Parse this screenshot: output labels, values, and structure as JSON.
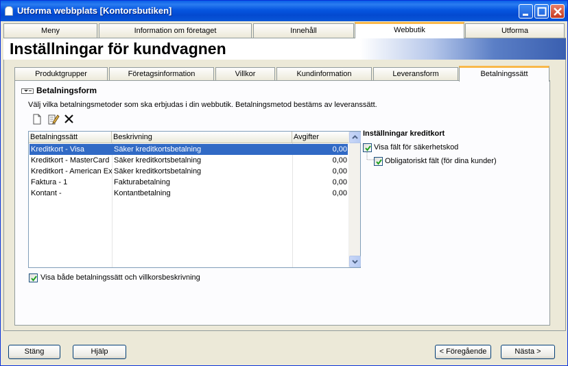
{
  "window": {
    "title": "Utforma webbplats [Kontorsbutiken]"
  },
  "top_tabs": [
    "Meny",
    "Information om företaget",
    "Innehåll",
    "Webbutik",
    "Utforma"
  ],
  "page_title": "Inställningar för kundvagnen",
  "sub_tabs": [
    "Produktgrupper",
    "Företagsinformation",
    "Villkor",
    "Kundinformation",
    "Leveransform",
    "Betalningssätt"
  ],
  "section": {
    "title": "Betalningsform",
    "description": "Välj vilka betalningsmetoder som ska erbjudas i din webbutik. Betalningsmetod bestäms av leveranssätt."
  },
  "toolbar": {
    "icons": [
      "new-document-icon",
      "edit-icon",
      "delete-icon"
    ]
  },
  "list": {
    "headers": [
      "Betalningssätt",
      "Beskrivning",
      "Avgifter"
    ],
    "rows": [
      {
        "name": "Kreditkort - Visa",
        "desc": "Säker kreditkortsbetalning",
        "fee": "0,00"
      },
      {
        "name": "Kreditkort - MasterCard",
        "desc": "Säker kreditkortsbetalning",
        "fee": "0,00"
      },
      {
        "name": "Kreditkort - American Exp",
        "desc": "Säker kreditkortsbetalning",
        "fee": "0,00"
      },
      {
        "name": "Faktura - 1",
        "desc": "Fakturabetalning",
        "fee": "0,00"
      },
      {
        "name": "Kontant -",
        "desc": "Kontantbetalning",
        "fee": "0,00"
      }
    ]
  },
  "show_both_checkbox": {
    "label": "Visa både betalningssätt och villkorsbeskrivning",
    "checked": true
  },
  "credit_card": {
    "title": "Inställningar kreditkort",
    "show_security": {
      "label": "Visa fält för säkerhetskod",
      "checked": true
    },
    "mandatory": {
      "label": "Obligatoriskt fält (för dina kunder)",
      "checked": true
    }
  },
  "buttons": {
    "close": "Stäng",
    "help": "Hjälp",
    "previous": "< Föregående",
    "next": "Nästa >"
  },
  "colors": {
    "titlebar": "#0a5fe8",
    "selection": "#316ac5",
    "active_tab_accent": "#f9b84a"
  }
}
